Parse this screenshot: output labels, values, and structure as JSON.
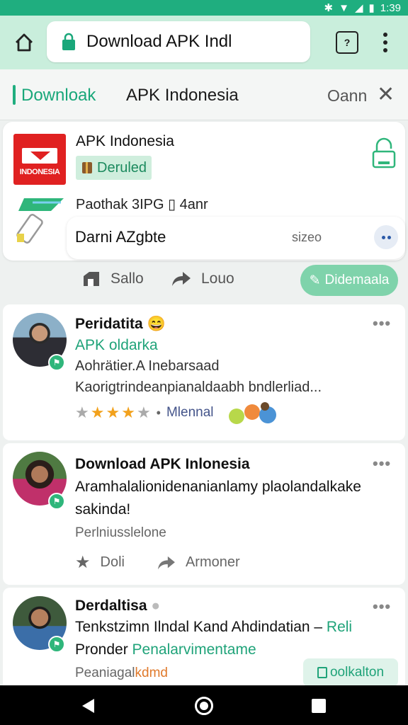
{
  "status_bar": {
    "time": "1:39"
  },
  "browser": {
    "url_title": "Download APK Indl"
  },
  "tabs": {
    "active": "Downloak",
    "second": "APK Indonesia",
    "open_label": "Oann"
  },
  "app_card": {
    "name": "APK Indonesia",
    "logo_text": "INDONESIA",
    "download_label": "Deruled",
    "package_info": "Paothak 3IPG  ▯  4anr",
    "search_value": "Darni AZgbte",
    "search_right": "sizeo"
  },
  "actions": {
    "save": "Sallo",
    "share": "Louo",
    "primary": "Didemaala"
  },
  "posts": [
    {
      "title": "Peridatita 😄",
      "subtitle": "APK oldarka",
      "body": "Aohrätier.A Inebarsaad Kaorigtrindeanpianaldaabh bndlerliad...",
      "rating_label": "Mlennal"
    },
    {
      "title": "Download APK Inlonesia",
      "body": "Aramhalalionidenanianlamy plaolandalkake sakinda!",
      "meta": "Perlniusslelone",
      "action1": "Doli",
      "action2": "Armoner"
    },
    {
      "title": "Derdaltisa",
      "body_main": "Tenkstzimn Ilndal Kand Ahdindatian – ",
      "body_link": "Reli",
      "body2_main": "Pronder ",
      "body2_link": "Penalarvimentame",
      "meta_main": "Peaniagal",
      "meta_link": "kdmd",
      "button": "oolkalton"
    }
  ],
  "colors": {
    "accent": "#1fae7f",
    "browser_bar": "#c9eedc",
    "logo_red": "#e02121"
  },
  "icons": [
    "home-icon",
    "lock-icon",
    "tabs-icon",
    "more-vert-icon",
    "close-icon",
    "padlock-icon",
    "save-icon",
    "share-icon",
    "star-icon",
    "back-icon",
    "circle-home-icon",
    "recent-icon"
  ]
}
